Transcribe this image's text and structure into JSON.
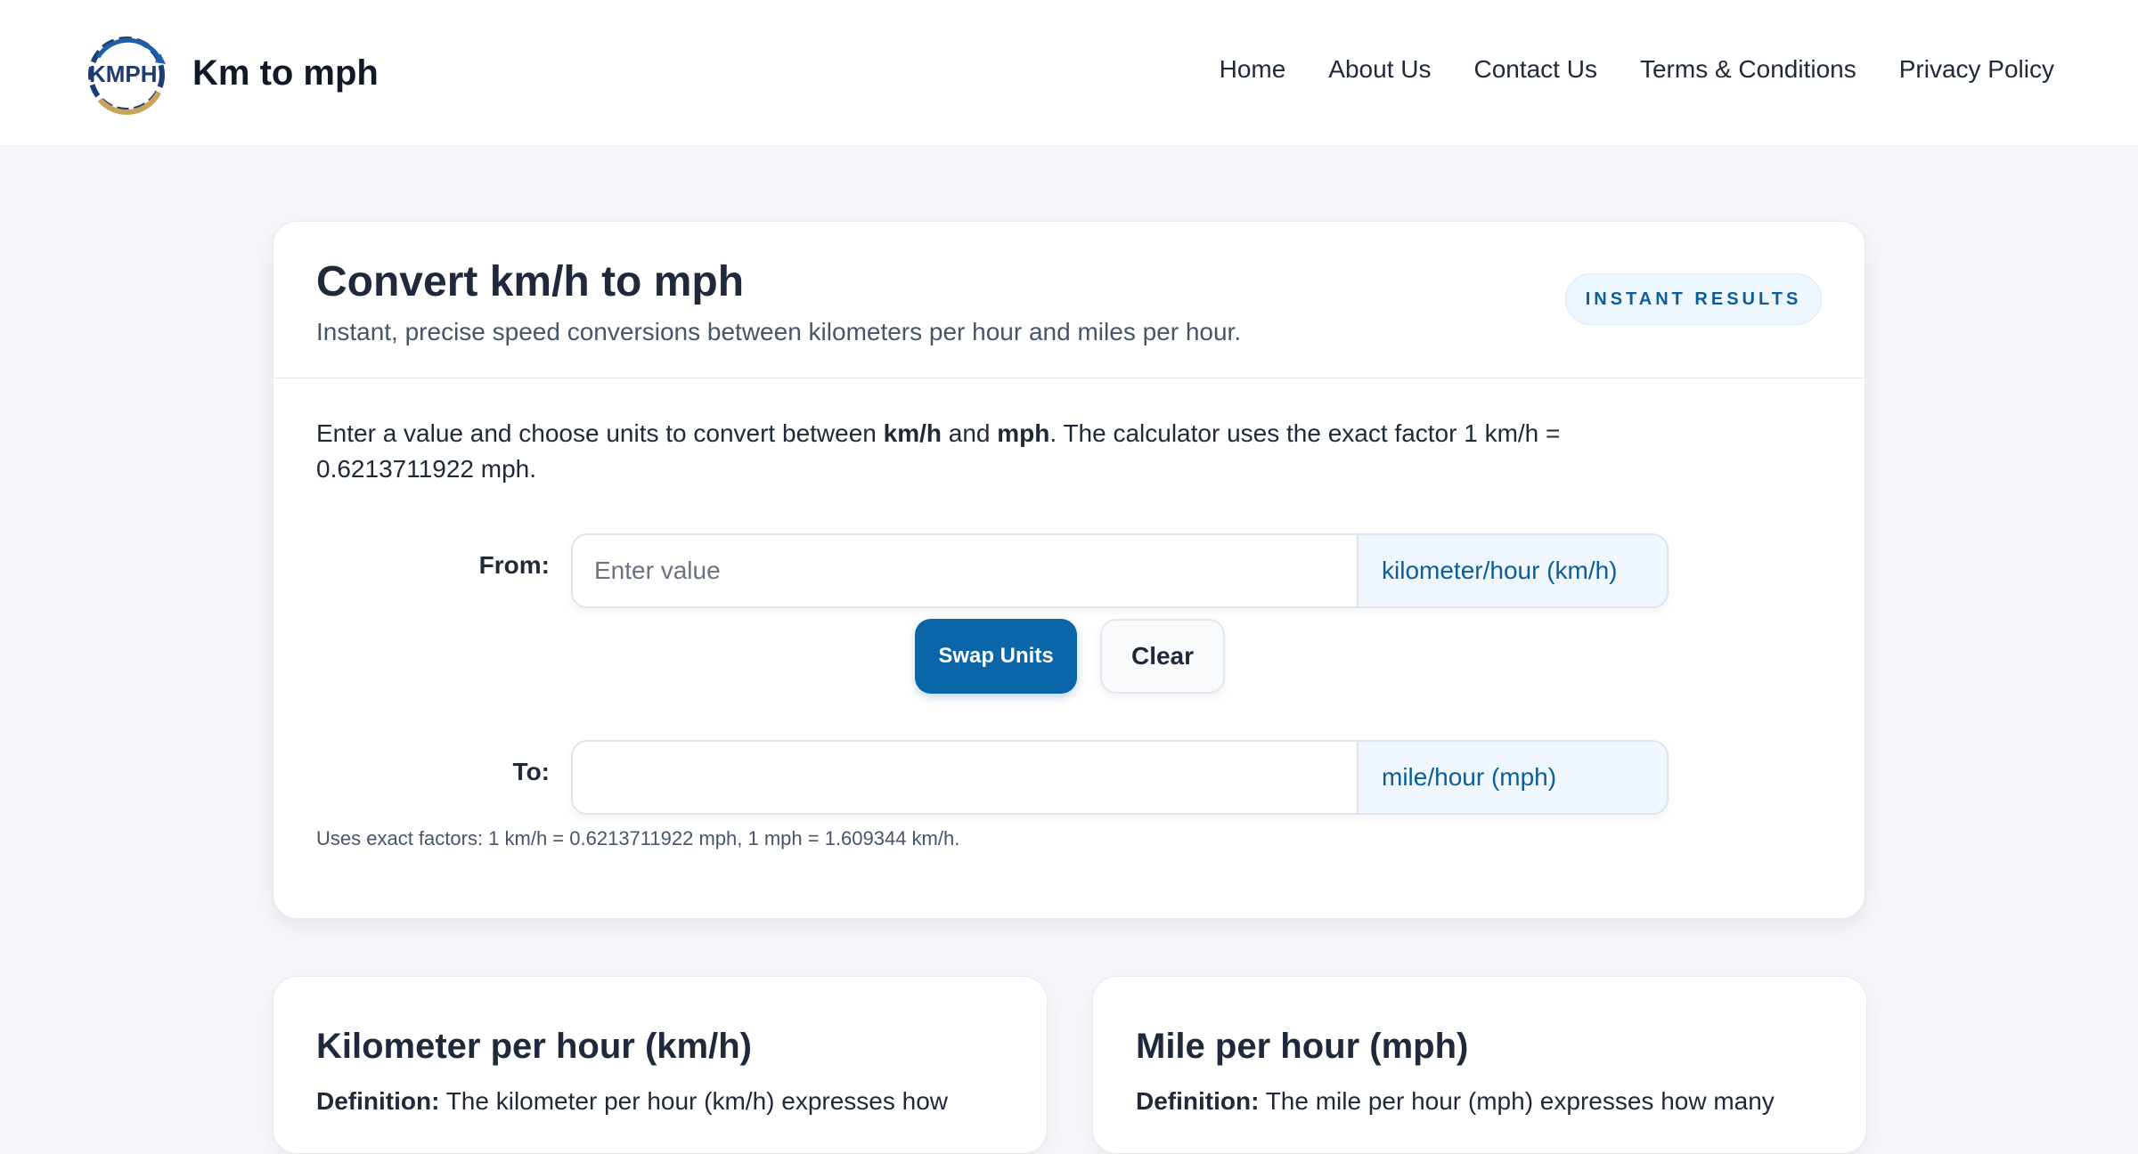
{
  "brand": {
    "name": "Km to mph",
    "logo_text": "KMPH"
  },
  "nav": {
    "items": [
      {
        "label": "Home"
      },
      {
        "label": "About Us"
      },
      {
        "label": "Contact Us"
      },
      {
        "label": "Terms & Conditions"
      },
      {
        "label": "Privacy Policy"
      }
    ]
  },
  "converter": {
    "title": "Convert km/h to mph",
    "subtitle": "Instant, precise speed conversions between kilometers per hour and miles per hour.",
    "badge": "INSTANT RESULTS",
    "intro_pre": "Enter a value and choose units to convert between ",
    "intro_unit1": "km/h",
    "intro_and": " and ",
    "intro_unit2": "mph",
    "intro_post": ". The calculator uses the exact factor 1 km/h = 0.6213711922 mph.",
    "from_label": "From:",
    "from_placeholder": "Enter value",
    "from_value": "",
    "from_unit": "kilometer/hour (km/h)",
    "to_label": "To:",
    "to_value": "",
    "to_unit": "mile/hour (mph)",
    "swap_label": "Swap Units",
    "clear_label": "Clear",
    "note": "Uses exact factors: 1 km/h = 0.6213711922 mph, 1 mph = 1.609344 km/h."
  },
  "info_cards": [
    {
      "title": "Kilometer per hour (km/h)",
      "def_label": "Definition:",
      "def_text": " The kilometer per hour (km/h) expresses how"
    },
    {
      "title": "Mile per hour (mph)",
      "def_label": "Definition:",
      "def_text": " The mile per hour (mph) expresses how many"
    }
  ],
  "colors": {
    "accent": "#0b65a9",
    "accent_text": "#0b5e99",
    "background": "#f5f7fa"
  },
  "icons": {
    "logo": "speedometer-logo-icon"
  }
}
